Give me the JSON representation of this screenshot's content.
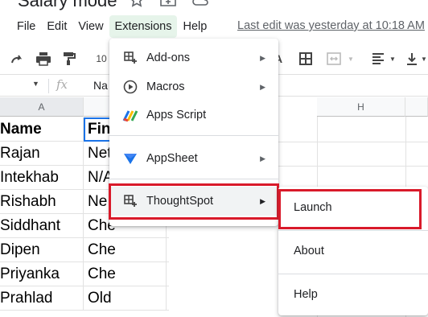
{
  "document": {
    "title": "Salary mode"
  },
  "menubar": {
    "items": [
      "File",
      "Edit",
      "View",
      "Extensions",
      "Help"
    ],
    "active": "Extensions",
    "last_edit": "Last edit was yesterday at 10:18 AM"
  },
  "toolbar": {
    "font_size_partial": "10"
  },
  "formula_bar": {
    "fx": "fx",
    "value_partial": "Na"
  },
  "grid": {
    "columns": [
      "A",
      "H"
    ],
    "rows": [
      {
        "a": "Name",
        "b": "Fin"
      },
      {
        "a": "Rajan",
        "b": "Net"
      },
      {
        "a": "Intekhab",
        "b": "N/A"
      },
      {
        "a": "Rishabh",
        "b": "Ne"
      },
      {
        "a": "Siddhant",
        "b": "Che"
      },
      {
        "a": "Dipen",
        "b": "Che"
      },
      {
        "a": "Priyanka",
        "b": "Che"
      },
      {
        "a": "Prahlad",
        "b": "Old"
      }
    ]
  },
  "extensions_menu": {
    "items": [
      {
        "label": "Add-ons",
        "icon": "addons-icon",
        "has_submenu": true
      },
      {
        "label": "Macros",
        "icon": "macros-play-icon",
        "has_submenu": true
      },
      {
        "label": "Apps Script",
        "icon": "apps-script-icon",
        "has_submenu": false
      },
      {
        "label": "AppSheet",
        "icon": "appsheet-icon",
        "has_submenu": true
      },
      {
        "label": "ThoughtSpot",
        "icon": "thoughtspot-icon",
        "has_submenu": true
      }
    ]
  },
  "thoughtspot_submenu": {
    "items": [
      "Launch",
      "About",
      "Help"
    ]
  },
  "colors": {
    "highlight_red": "#d91a2a",
    "extensions_active_bg": "#e6f4ea",
    "selection_blue": "#1a73e8"
  }
}
